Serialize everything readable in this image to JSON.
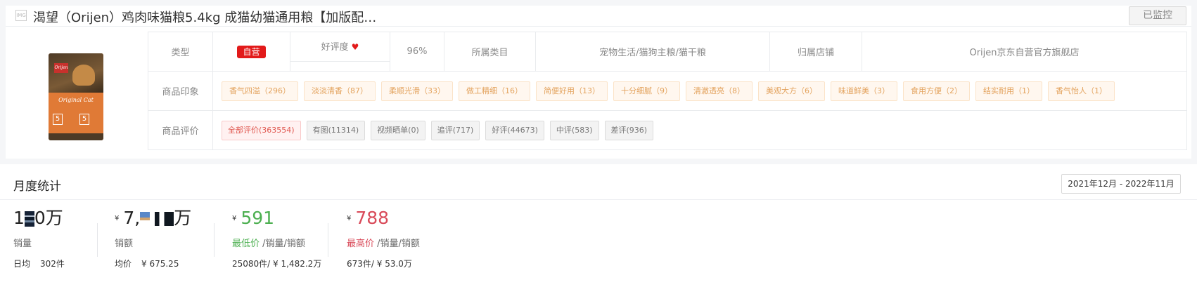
{
  "product": {
    "title": "渴望（Orijen）鸡肉味猫粮5.4kg 成猫幼猫通用粮【加版配…",
    "monitor_label": "已监控",
    "image_alt": "product-bag",
    "bag_label": "Original Cat",
    "bag_brand": "Orijen"
  },
  "info": {
    "type_label": "类型",
    "type_value": "自营",
    "haoping_label": "好评度",
    "haoping_value": "96%",
    "category_label": "所属类目",
    "category_value": "宠物生活/猫狗主粮/猫干粮",
    "shop_label": "归属店铺",
    "shop_value": "Orijen京东自营官方旗舰店",
    "impression_label": "商品印象",
    "impressions": [
      "香气四溢（296）",
      "淡淡清香（87）",
      "柔顺光滑（33）",
      "做工精细（16）",
      "简便好用（13）",
      "十分细腻（9）",
      "清澈透亮（8）",
      "美观大方（6）",
      "味道鲜美（3）",
      "食用方便（2）",
      "结实耐用（1）",
      "香气怡人（1）"
    ],
    "review_label": "商品评价",
    "reviews": [
      "全部评价(363554)",
      "有图(11314)",
      "视频晒单(0)",
      "追评(717)",
      "好评(44673)",
      "中评(583)",
      "差评(936)"
    ]
  },
  "monthly": {
    "title": "月度统计",
    "date_range": "2021年12月 - 2022年11月",
    "sales": {
      "value_prefix": "1",
      "value_suffix": "0万",
      "label": "销量",
      "daily_label": "日均",
      "daily_value": "302件"
    },
    "revenue": {
      "currency": "¥",
      "value_prefix": "7,",
      "value_suffix": "万",
      "label": "销额",
      "avg_label": "均价",
      "avg_value": "¥ 675.25"
    },
    "min_price": {
      "currency": "¥",
      "value": "591",
      "label": "最低价",
      "label_suffix": "/销量/销额",
      "detail": "25080件/ ¥ 1,482.2万"
    },
    "max_price": {
      "currency": "¥",
      "value": "788",
      "label": "最高价",
      "label_suffix": "/销量/销额",
      "detail": "673件/ ¥ 53.0万"
    }
  },
  "colors": {
    "accent_red": "#e21a1a",
    "min_green": "#4caf50",
    "max_red": "#d94b5a",
    "tag_orange": "#e3a35e"
  }
}
